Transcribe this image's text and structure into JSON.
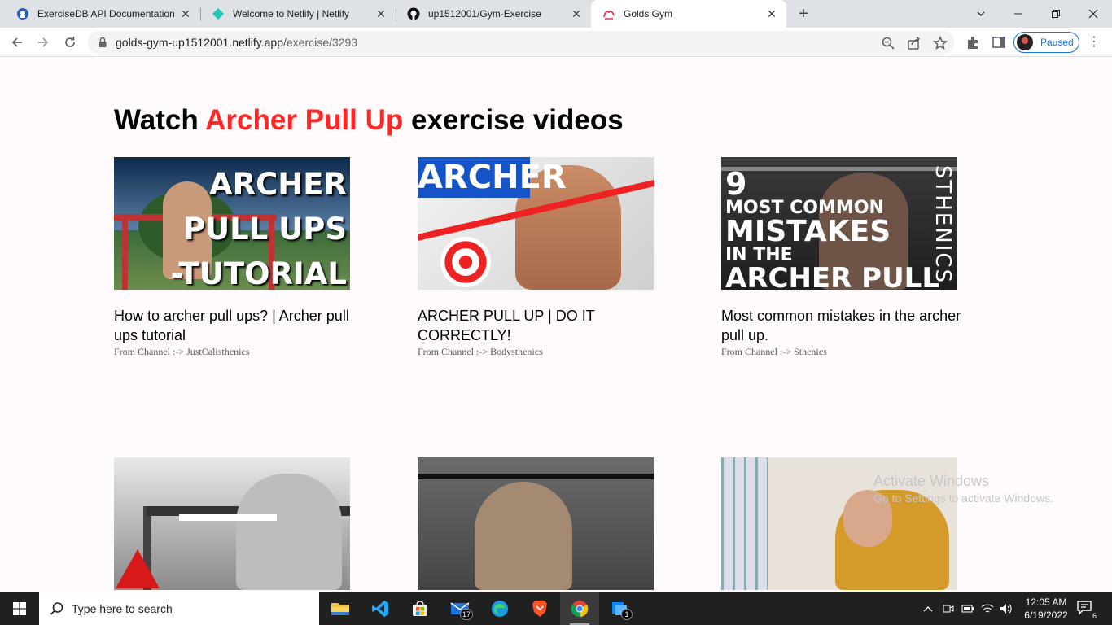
{
  "browser": {
    "tabs": [
      {
        "title": "ExerciseDB API Documentation (R",
        "icon": "rapidapi-icon"
      },
      {
        "title": "Welcome to Netlify | Netlify",
        "icon": "netlify-icon"
      },
      {
        "title": "up1512001/Gym-Exercise",
        "icon": "github-icon"
      },
      {
        "title": "Golds Gym",
        "icon": "gym-logo-icon"
      }
    ],
    "url_host": "golds-gym-up1512001.netlify.app",
    "url_path": "/exercise/3293",
    "profile_label": "Paused"
  },
  "page": {
    "heading_prefix": "Watch ",
    "exercise_name": "Archer Pull Up",
    "heading_suffix": " exercise videos",
    "accent_color": "#ff2625",
    "videos": [
      {
        "title": "How to archer pull ups? | Archer pull ups tutorial",
        "channel": "From Channel :-> JustCalisthenics",
        "thumb_text": [
          "ARCHER",
          "PULL UPS",
          "-TUTORIAL"
        ]
      },
      {
        "title": "ARCHER PULL UP | DO IT CORRECTLY!",
        "channel": "From Channel :-> Bodysthenics",
        "thumb_text": [
          "ARCHER"
        ]
      },
      {
        "title": "Most common mistakes in the archer pull up.",
        "channel": "From Channel :-> Sthenics",
        "thumb_text": [
          "9",
          "MOST COMMON",
          "MISTAKES",
          "IN THE",
          "ARCHER PULL UP",
          "STHENICS"
        ]
      },
      {
        "title": "",
        "channel": ""
      },
      {
        "title": "",
        "channel": ""
      },
      {
        "title": "",
        "channel": ""
      }
    ]
  },
  "watermark": {
    "line1": "Activate Windows",
    "line2": "Go to Settings to activate Windows."
  },
  "taskbar": {
    "search_placeholder": "Type here to search",
    "mail_badge": "17",
    "app_badge": "1",
    "time": "12:05 AM",
    "date": "6/19/2022",
    "notification_count": "6"
  }
}
